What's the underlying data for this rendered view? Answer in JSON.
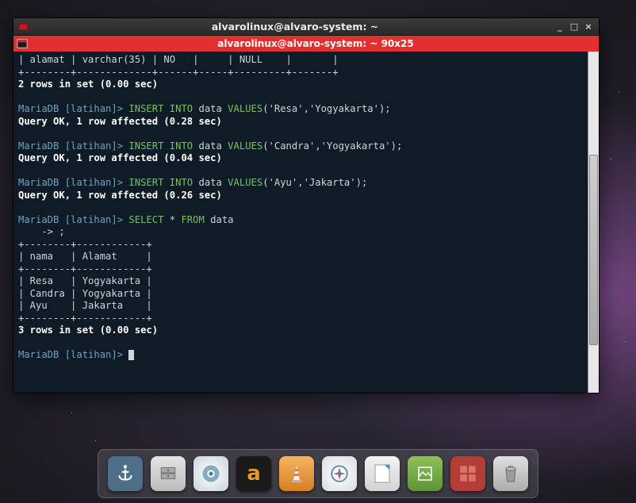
{
  "window": {
    "title": "alvarolinux@alvaro-system: ~",
    "tab_title": "alvarolinux@alvaro-system: ~ 90x25",
    "btn_min": "_",
    "btn_max": "□",
    "btn_close": "×"
  },
  "terminal": {
    "row0": "| alamat | varchar(35) | NO   |     | NULL    |       |",
    "row1": "+--------+-------------+------+-----+---------+-------+",
    "rows_msg1": "2 rows in set (0.00 sec)",
    "prompt": "MariaDB [latihan]>",
    "cont_prompt": "    -> ;",
    "insert1_sql": " data ",
    "insert1_vals": "('Resa','Yogyakarta');",
    "ok1": "Query OK, 1 row affected (0.28 sec)",
    "insert2_vals": "('Candra','Yogyakarta');",
    "ok2": "Query OK, 1 row affected (0.04 sec)",
    "insert3_vals": "('Ayu','Jakarta');",
    "ok3": "Query OK, 1 row affected (0.26 sec)",
    "select_tbl": " * ",
    "select_from_tbl": " data",
    "tb_sep": "+--------+------------+",
    "tb_head": "| nama   | Alamat     |",
    "tb_r1": "| Resa   | Yogyakarta |",
    "tb_r2": "| Candra | Yogyakarta |",
    "tb_r3": "| Ayu    | Jakarta    |",
    "rows_msg2": "3 rows in set (0.00 sec)",
    "kw_insert": "INSERT INTO",
    "kw_values": "VALUES",
    "kw_select": "SELECT",
    "kw_from": "FROM"
  },
  "dock": {
    "items": [
      {
        "name": "anchor",
        "bg": "#4f6e8a"
      },
      {
        "name": "files",
        "bg": "#cfcfcf"
      },
      {
        "name": "chromium",
        "bg": "#dadee2"
      },
      {
        "name": "audacious",
        "bg": "#1a1a1a"
      },
      {
        "name": "vlc",
        "bg": "#e08a2e"
      },
      {
        "name": "compass",
        "bg": "#ececec"
      },
      {
        "name": "libreoffice",
        "bg": "#dedede"
      },
      {
        "name": "drawing",
        "bg": "#74a746"
      },
      {
        "name": "workspaces",
        "bg": "#b13d34"
      },
      {
        "name": "trash",
        "bg": "#c9c9c9"
      }
    ]
  }
}
